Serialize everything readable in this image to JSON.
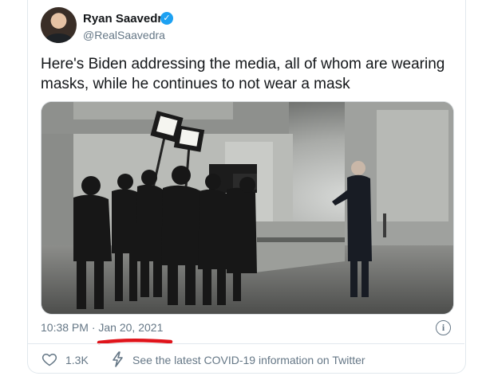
{
  "tweet": {
    "author_name": "Ryan Saavedra",
    "verified_mark": "✓",
    "author_handle": "@RealSaavedra",
    "text": "Here's Biden addressing the media, all of whom are wearing masks, while he continues to not wear a mask",
    "time": "10:38 PM",
    "separator": "·",
    "date": "Jan 20, 2021",
    "info_symbol": "i"
  },
  "footer": {
    "like_count": "1.3K",
    "covid_link_text": "See the latest COVID-19 information on Twitter"
  },
  "colors": {
    "verified_blue": "#1da1f2",
    "muted_text": "#657786",
    "annotation_red": "#e0141b"
  },
  "icons": [
    "heart-icon",
    "bolt-icon",
    "info-icon",
    "verified-badge-icon"
  ]
}
